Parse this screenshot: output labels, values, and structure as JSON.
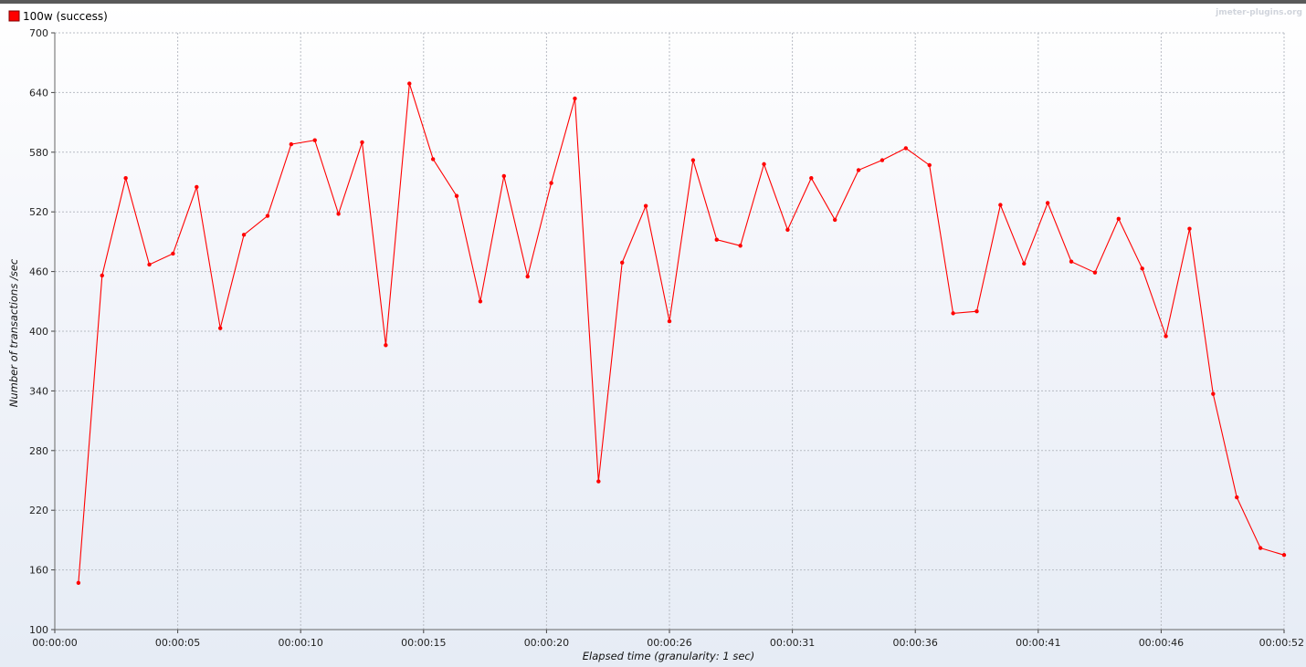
{
  "chart_data": {
    "type": "line",
    "watermark": "jmeter-plugins.org",
    "xlabel": "Elapsed time (granularity: 1 sec)",
    "ylabel": "Number of transactions /sec",
    "ylim": [
      100,
      700
    ],
    "yticks": [
      100,
      160,
      220,
      280,
      340,
      400,
      460,
      520,
      580,
      640,
      700
    ],
    "xlim": [
      0,
      52
    ],
    "xticks": [
      {
        "t": 0,
        "label": "00:00:00"
      },
      {
        "t": 5.2,
        "label": "00:00:05"
      },
      {
        "t": 10.4,
        "label": "00:00:10"
      },
      {
        "t": 15.6,
        "label": "00:00:15"
      },
      {
        "t": 20.8,
        "label": "00:00:20"
      },
      {
        "t": 26,
        "label": "00:00:26"
      },
      {
        "t": 31.2,
        "label": "00:00:31"
      },
      {
        "t": 36.4,
        "label": "00:00:36"
      },
      {
        "t": 41.6,
        "label": "00:00:41"
      },
      {
        "t": 46.8,
        "label": "00:00:46"
      },
      {
        "t": 52,
        "label": "00:00:52"
      }
    ],
    "grid": true,
    "legend_position": "top-left",
    "series": [
      {
        "name": "100w (success)",
        "color": "#ff0000",
        "x": [
          1,
          2,
          3,
          4,
          5,
          6,
          7,
          8,
          9,
          10,
          11,
          12,
          13,
          14,
          15,
          16,
          17,
          18,
          19,
          20,
          21,
          22,
          23,
          24,
          25,
          26,
          27,
          28,
          29,
          30,
          31,
          32,
          33,
          34,
          35,
          36,
          37,
          38,
          39,
          40,
          41,
          42,
          43,
          44,
          45,
          46,
          47,
          48,
          49,
          50,
          51,
          52
        ],
        "values": [
          147,
          456,
          554,
          467,
          478,
          545,
          403,
          497,
          516,
          588,
          592,
          518,
          590,
          386,
          649,
          573,
          536,
          430,
          556,
          455,
          549,
          634,
          249,
          469,
          526,
          410,
          572,
          492,
          486,
          568,
          502,
          554,
          512,
          562,
          572,
          584,
          567,
          418,
          420,
          527,
          468,
          529,
          470,
          459,
          513,
          463,
          395,
          503,
          337,
          233,
          182,
          175
        ]
      }
    ]
  }
}
